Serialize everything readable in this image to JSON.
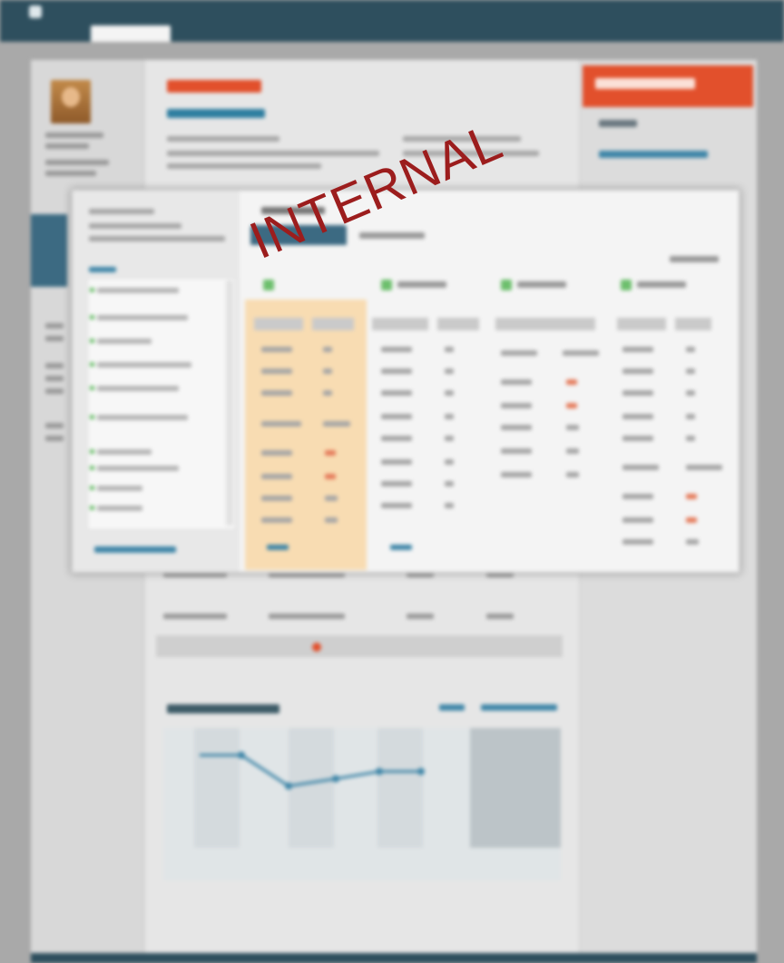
{
  "watermark": {
    "text": "INTERNAL"
  },
  "colors": {
    "accent_red": "#e2502c",
    "brand_dark": "#2e4f5e",
    "active_tab": "#3c6a82",
    "link_blue": "#3f86a8",
    "watermark_red": "#9c1d1d",
    "highlight": "#f8dcb2",
    "status_green": "#6dbf6d"
  },
  "icons": [
    "app-logo-icon",
    "user-avatar",
    "tree-node-icon",
    "legend-swatch-icon",
    "alert-dot-icon"
  ]
}
